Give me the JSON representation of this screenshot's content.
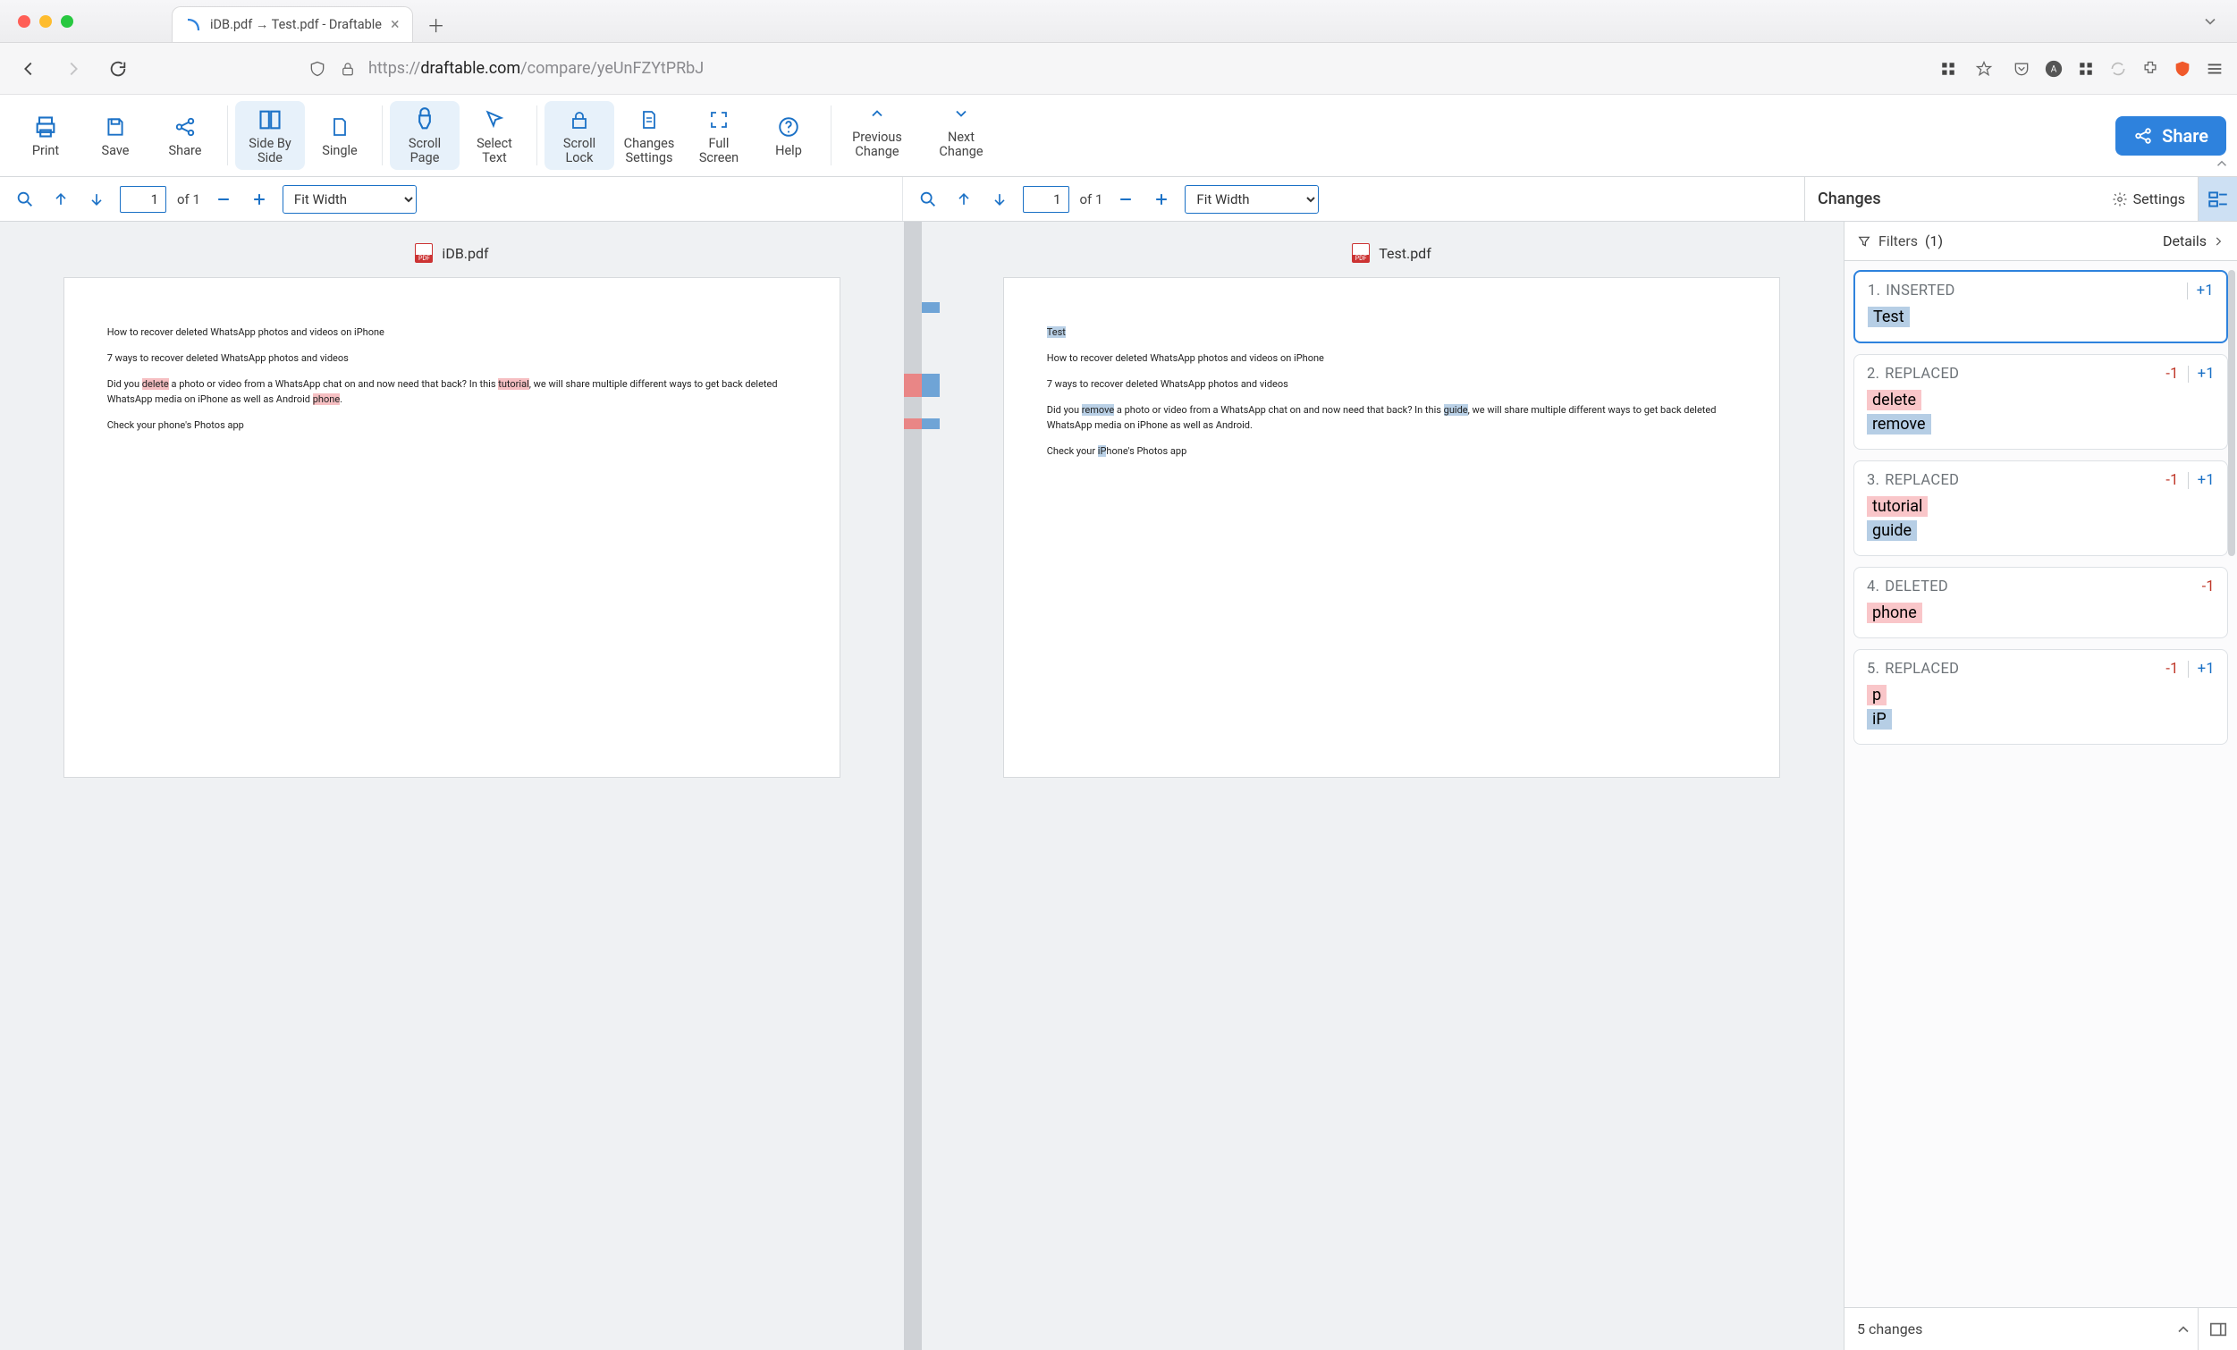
{
  "browser": {
    "tab_title": "iDB.pdf → Test.pdf - Draftable",
    "url_protocol": "https://",
    "url_domain": "draftable.com",
    "url_path": "/compare/yeUnFZYtPRbJ"
  },
  "toolbar": {
    "print": "Print",
    "save": "Save",
    "share": "Share",
    "side_by_side": "Side By\nSide",
    "single": "Single",
    "scroll_page": "Scroll\nPage",
    "select_text": "Select\nText",
    "scroll_lock": "Scroll\nLock",
    "changes_settings": "Changes\nSettings",
    "full_screen": "Full\nScreen",
    "help": "Help",
    "previous_change": "Previous\nChange",
    "next_change": "Next\nChange",
    "share_pill": "Share"
  },
  "docnav": {
    "left": {
      "page": "1",
      "of": "of 1",
      "zoom": "Fit Width"
    },
    "right": {
      "page": "1",
      "of": "of 1",
      "zoom": "Fit Width"
    }
  },
  "changes_header": {
    "title": "Changes",
    "settings": "Settings"
  },
  "filters": {
    "label": "Filters",
    "count": "(1)",
    "details": "Details"
  },
  "left_doc": {
    "name": "iDB.pdf",
    "p1": "How to recover deleted WhatsApp photos and videos on iPhone",
    "p2": "7 ways to recover deleted WhatsApp photos and videos",
    "p3_a": "Did you ",
    "p3_del1": "delete",
    "p3_b": " a photo or video from a WhatsApp chat on and now need that back? In this ",
    "p3_del2": "tutorial",
    "p3_c": ", we will share multiple different ways to get back deleted WhatsApp media on iPhone as well as Android ",
    "p3_del3": "phone",
    "p3_d": ".",
    "p4": "Check your phone's Photos app"
  },
  "right_doc": {
    "name": "Test.pdf",
    "ins1": "Test",
    "p1": "How to recover deleted WhatsApp photos and videos on iPhone",
    "p2": "7 ways to recover deleted WhatsApp photos and videos",
    "p3_a": "Did you ",
    "p3_ins1": "remove",
    "p3_b": " a photo or video from a WhatsApp chat on and now need that back? In this ",
    "p3_ins2": "guide",
    "p3_c": ", we will share multiple different ways to get back deleted WhatsApp media on iPhone as well as Android.",
    "p4_a": "Check your ",
    "p4_ins": "iP",
    "p4_b": "hone's Photos app"
  },
  "changes": [
    {
      "idx": "1.",
      "type": "INSERTED",
      "minus": "",
      "plus": "+1",
      "red": "",
      "blue": "Test"
    },
    {
      "idx": "2.",
      "type": "REPLACED",
      "minus": "-1",
      "plus": "+1",
      "red": "delete",
      "blue": "remove"
    },
    {
      "idx": "3.",
      "type": "REPLACED",
      "minus": "-1",
      "plus": "+1",
      "red": "tutorial",
      "blue": "guide"
    },
    {
      "idx": "4.",
      "type": "DELETED",
      "minus": "-1",
      "plus": "",
      "red": "phone",
      "blue": ""
    },
    {
      "idx": "5.",
      "type": "REPLACED",
      "minus": "-1",
      "plus": "+1",
      "red": "p",
      "blue": "iP"
    }
  ],
  "footer": {
    "count": "5 changes"
  }
}
